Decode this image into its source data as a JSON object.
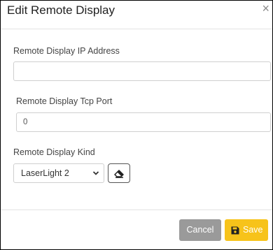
{
  "dialog": {
    "title": "Edit Remote Display",
    "close_glyph": "×"
  },
  "fields": {
    "ip_label": "Remote Display IP Address",
    "ip_value": "",
    "port_label": "Remote Display Tcp Port",
    "port_value": "0",
    "kind_label": "Remote Display Kind",
    "kind_value": "LaserLight 2"
  },
  "icons": {
    "close": "close-icon",
    "chevron": "chevron-down-icon",
    "eraser": "eraser-icon",
    "save": "save-icon"
  },
  "buttons": {
    "cancel_label": "Cancel",
    "save_label": "Save"
  },
  "colors": {
    "cancel_bg": "#9a9a9a",
    "save_bg": "#f7c31a"
  }
}
